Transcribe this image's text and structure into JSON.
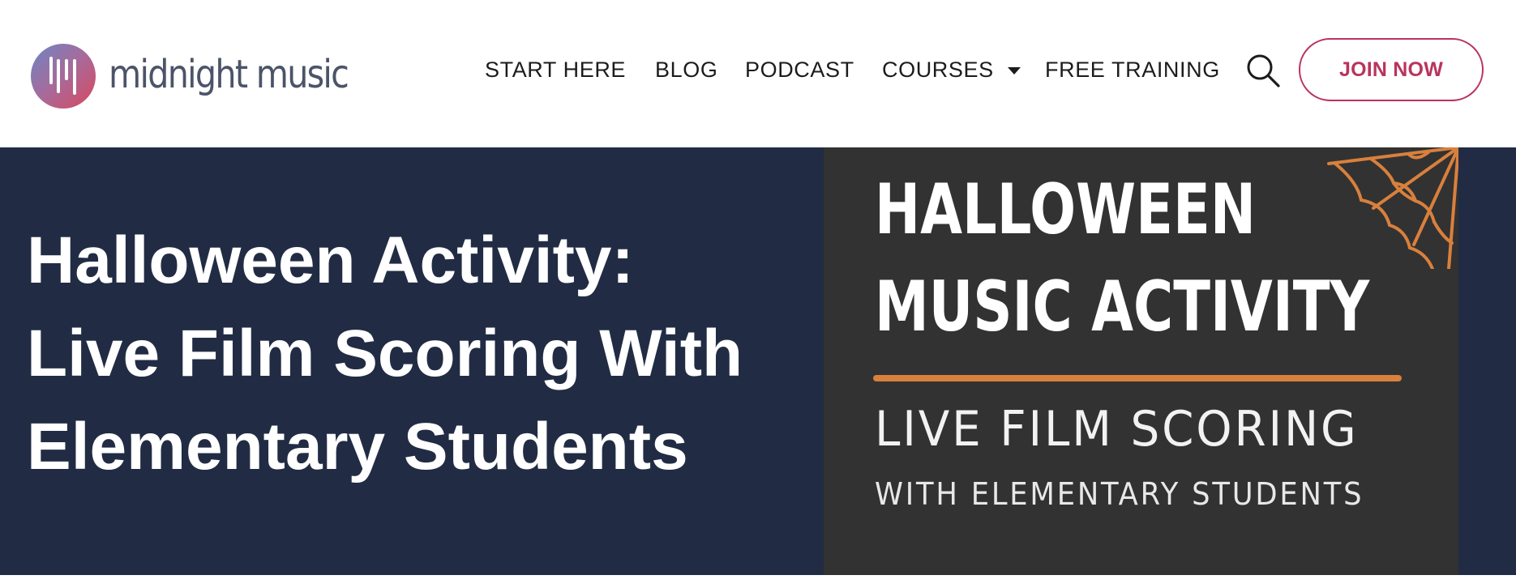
{
  "brand": {
    "name": "midnight music",
    "colors": {
      "accent": "#b9345c",
      "hero_bg": "#212c44",
      "feature_bg": "#323232",
      "feature_accent": "#d9803d",
      "logo_text": "#4b5468"
    }
  },
  "nav": {
    "items": [
      {
        "label": "START HERE"
      },
      {
        "label": "BLOG"
      },
      {
        "label": "PODCAST"
      },
      {
        "label": "COURSES",
        "has_dropdown": true,
        "icon": "caret-down-icon"
      },
      {
        "label": "FREE TRAINING"
      }
    ],
    "search_icon": "search-icon",
    "cta_label": "JOIN NOW"
  },
  "hero": {
    "title_lines": [
      "Halloween Activity:",
      "Live Film Scoring With",
      "Elementary Students"
    ]
  },
  "feature_image": {
    "title_line1": "HALLOWEEN",
    "title_line2": "MUSIC ACTIVITY",
    "subtitle_line1": "LIVE FILM SCORING",
    "subtitle_line2": "WITH ELEMENTARY STUDENTS",
    "decoration": "cobweb"
  }
}
